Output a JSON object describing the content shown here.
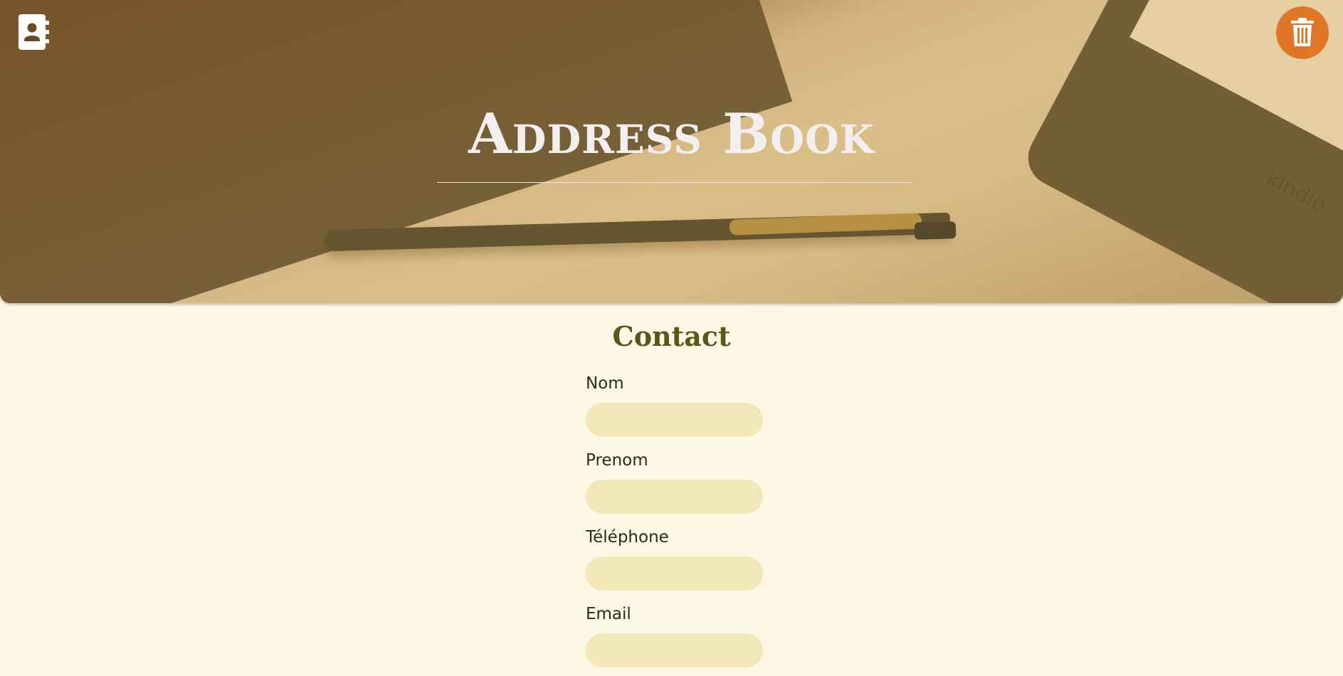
{
  "header": {
    "title": "Address Book",
    "contacts_icon": "address-book-icon",
    "delete_icon": "trash-icon",
    "delete_button_color": "#e07628",
    "reader_brand": "kindle"
  },
  "form": {
    "title": "Contact",
    "title_color": "#5c5418",
    "fields": [
      {
        "label": "Nom",
        "value": "",
        "placeholder": ""
      },
      {
        "label": "Prenom",
        "value": "",
        "placeholder": ""
      },
      {
        "label": "Téléphone",
        "value": "",
        "placeholder": ""
      },
      {
        "label": "Email",
        "value": "",
        "placeholder": ""
      }
    ]
  },
  "colors": {
    "background": "#fdf8e6",
    "input_fill": "#f1e7b8"
  }
}
